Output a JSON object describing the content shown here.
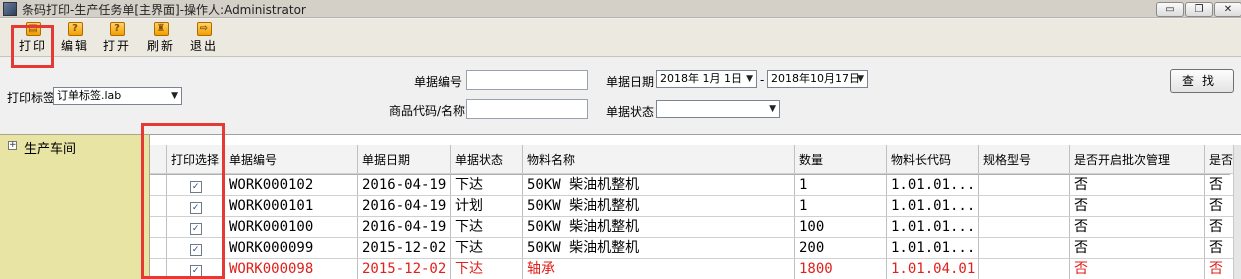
{
  "window": {
    "title": "条码打印-生产任务单[主界面]-操作人:Administrator",
    "min": "▭",
    "max": "❐",
    "close": "✕"
  },
  "toolbar": {
    "buttons": [
      {
        "label": "打印",
        "icon": "print-icon"
      },
      {
        "label": "编辑",
        "icon": "edit-icon"
      },
      {
        "label": "打开",
        "icon": "open-icon"
      },
      {
        "label": "刷新",
        "icon": "refresh-icon"
      },
      {
        "label": "退出",
        "icon": "exit-icon"
      }
    ]
  },
  "filters": {
    "print_label_caption": "打印标签",
    "print_label_value": "订单标签.lab",
    "doc_no_caption": "单据编号",
    "doc_no_value": "",
    "product_caption": "商品代码/名称",
    "product_value": "",
    "doc_date_caption": "单据日期",
    "date_from": "2018年 1月 1日",
    "date_sep": "-",
    "date_to": "2018年10月17日",
    "doc_status_caption": "单据状态",
    "doc_status_value": "",
    "search_label": "查找"
  },
  "tree": {
    "expander": "+",
    "root_label": "生产车间"
  },
  "grid": {
    "columns": [
      "打印选择",
      "单据编号",
      "单据日期",
      "单据状态",
      "物料名称",
      "数量",
      "物料长代码",
      "规格型号",
      "是否开启批次管理",
      "是否"
    ],
    "rows": [
      {
        "checked": true,
        "doc_no": "WORK000102",
        "date": "2016-04-19",
        "status": "下达",
        "material": "50KW 柴油机整机",
        "qty": "1",
        "code": "1.01.01...",
        "spec": "",
        "batch": "否",
        "extra": "否",
        "highlight": false
      },
      {
        "checked": true,
        "doc_no": "WORK000101",
        "date": "2016-04-19",
        "status": "计划",
        "material": "50KW 柴油机整机",
        "qty": "1",
        "code": "1.01.01...",
        "spec": "",
        "batch": "否",
        "extra": "否",
        "highlight": false
      },
      {
        "checked": true,
        "doc_no": "WORK000100",
        "date": "2016-04-19",
        "status": "下达",
        "material": "50KW 柴油机整机",
        "qty": "100",
        "code": "1.01.01...",
        "spec": "",
        "batch": "否",
        "extra": "否",
        "highlight": false
      },
      {
        "checked": true,
        "doc_no": "WORK000099",
        "date": "2015-12-02",
        "status": "下达",
        "material": "50KW 柴油机整机",
        "qty": "200",
        "code": "1.01.01...",
        "spec": "",
        "batch": "否",
        "extra": "否",
        "highlight": false
      },
      {
        "checked": true,
        "doc_no": "WORK000098",
        "date": "2015-12-02",
        "status": "下达",
        "material": "轴承",
        "qty": "1800",
        "code": "1.01.04.01",
        "spec": "",
        "batch": "否",
        "extra": "否",
        "highlight": true
      }
    ],
    "check_glyph": "✓"
  },
  "colors": {
    "annotation_red": "#e53935",
    "tree_bg": "#e8e4a4",
    "highlight_row_text": "#e0201a"
  }
}
